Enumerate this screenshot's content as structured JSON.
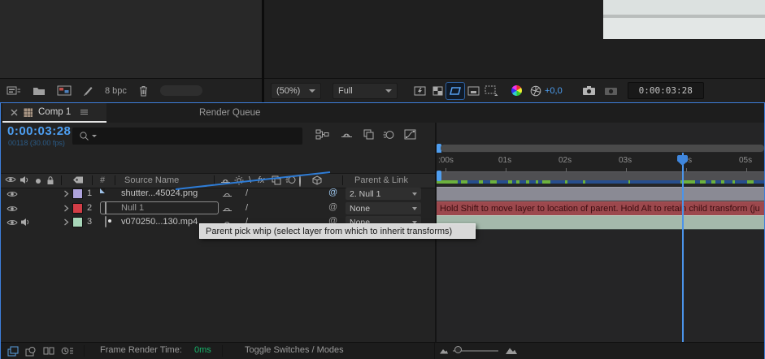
{
  "project": {
    "color_depth": "8 bpc"
  },
  "viewer": {
    "magnification": "(50%)",
    "resolution": "Full",
    "exposure": "+0,0",
    "timecode": "0:00:03:28"
  },
  "timeline": {
    "tab_comp": "Comp 1",
    "tab_render_queue": "Render Queue",
    "timecode": "0:00:03:28",
    "frame_info": "00118 (30.00 fps)",
    "columns": {
      "hash": "#",
      "source_name": "Source Name",
      "parent_link": "Parent & Link"
    },
    "layers": [
      {
        "num": "1",
        "name": "shutter...45024.png",
        "parent": "2. Null 1",
        "label_color": "#aea3dc"
      },
      {
        "num": "2",
        "name": "Null 1",
        "parent": "None",
        "label_color": "#d23d46"
      },
      {
        "num": "3",
        "name": "v070250...130.mp4",
        "parent": "None",
        "label_color": "#a8d6b9"
      }
    ],
    "ruler": [
      ":00s",
      "01s",
      "02s",
      "03s",
      "04s",
      "05s"
    ],
    "info_banner": "Hold Shift to move layer to location of parent. Hold Alt to retain child transform (ju",
    "tooltip": "Parent pick whip (select layer from which to inherit transforms)",
    "frame_render_label": "Frame Render Time:",
    "frame_render_value": "0ms",
    "toggle_switches_label": "Toggle Switches / Modes"
  },
  "glyphs": {
    "fx": "fx",
    "at": "@",
    "quality_slash": "/",
    "quality_backslash": "\\"
  },
  "colors": {
    "accent_blue": "#3d7edb",
    "timecode_blue": "#4d9ff2",
    "render_time_green": "#17b26a",
    "cache_green": "#6cb13e",
    "cache_blue": "#274e8d",
    "bar1": "#8a8a94",
    "bar2": "#9c484d",
    "bar3": "#a4b9ab"
  },
  "cache_segments": [
    [
      0,
      26
    ],
    [
      30,
      8
    ],
    [
      52,
      5
    ],
    [
      66,
      8
    ],
    [
      88,
      5
    ],
    [
      98,
      4
    ],
    [
      110,
      4
    ],
    [
      122,
      3
    ],
    [
      130,
      10
    ],
    [
      158,
      3
    ],
    [
      180,
      3
    ],
    [
      236,
      2
    ],
    [
      300,
      18
    ],
    [
      324,
      7
    ],
    [
      338,
      5
    ],
    [
      350,
      4
    ],
    [
      364,
      3
    ],
    [
      382,
      8
    ]
  ]
}
